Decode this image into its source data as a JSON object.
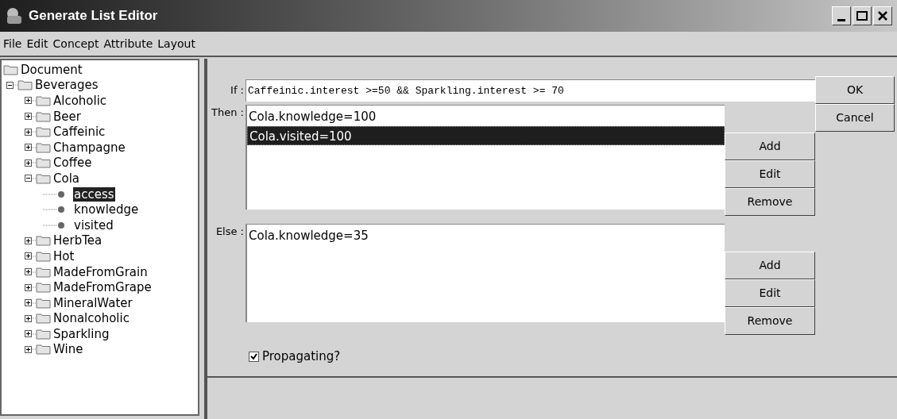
{
  "window": {
    "title": "Generate List Editor"
  },
  "menu": [
    "File",
    "Edit",
    "Concept",
    "Attribute",
    "Layout"
  ],
  "tree": [
    {
      "label": "Document",
      "kind": "folder",
      "selected": false,
      "children": [
        {
          "label": "Beverages",
          "kind": "folder",
          "selected": false,
          "expanded": true,
          "children": [
            {
              "label": "Alcoholic",
              "kind": "folder",
              "selected": false,
              "expanded": false
            },
            {
              "label": "Beer",
              "kind": "folder",
              "selected": false,
              "expanded": false
            },
            {
              "label": "Caffeinic",
              "kind": "folder",
              "selected": false,
              "expanded": false
            },
            {
              "label": "Champagne",
              "kind": "folder",
              "selected": false,
              "expanded": false
            },
            {
              "label": "Coffee",
              "kind": "folder",
              "selected": false,
              "expanded": false
            },
            {
              "label": "Cola",
              "kind": "folder",
              "selected": false,
              "expanded": true,
              "children": [
                {
                  "label": "access",
                  "kind": "attribute",
                  "selected": true
                },
                {
                  "label": "knowledge",
                  "kind": "attribute",
                  "selected": false
                },
                {
                  "label": "visited",
                  "kind": "attribute",
                  "selected": false
                }
              ]
            },
            {
              "label": "HerbTea",
              "kind": "folder",
              "selected": false,
              "expanded": false
            },
            {
              "label": "Hot",
              "kind": "folder",
              "selected": false,
              "expanded": false
            },
            {
              "label": "MadeFromGrain",
              "kind": "folder",
              "selected": false,
              "expanded": false
            },
            {
              "label": "MadeFromGrape",
              "kind": "folder",
              "selected": false,
              "expanded": false
            },
            {
              "label": "MineralWater",
              "kind": "folder",
              "selected": false,
              "expanded": false
            },
            {
              "label": "Nonalcoholic",
              "kind": "folder",
              "selected": false,
              "expanded": false
            },
            {
              "label": "Sparkling",
              "kind": "folder",
              "selected": false,
              "expanded": false
            },
            {
              "label": "Wine",
              "kind": "folder",
              "selected": false,
              "expanded": false
            }
          ]
        }
      ]
    }
  ],
  "if_field": {
    "label": "If :",
    "value": "Caffeinic.interest >=50 && Sparkling.interest >= 70"
  },
  "dialog_buttons": [
    "OK",
    "Cancel"
  ],
  "then_list": {
    "label": "Then :",
    "items": [
      {
        "text": "Cola.knowledge=100",
        "selected": false
      },
      {
        "text": "Cola.visited=100",
        "selected": true
      }
    ],
    "buttons": [
      "Add",
      "Edit",
      "Remove"
    ]
  },
  "else_list": {
    "label": "Else :",
    "items": [
      {
        "text": "Cola.knowledge=35",
        "selected": false
      }
    ],
    "buttons": [
      "Add",
      "Edit",
      "Remove"
    ]
  },
  "propagating": {
    "label": "Propagating?",
    "checked": true
  }
}
